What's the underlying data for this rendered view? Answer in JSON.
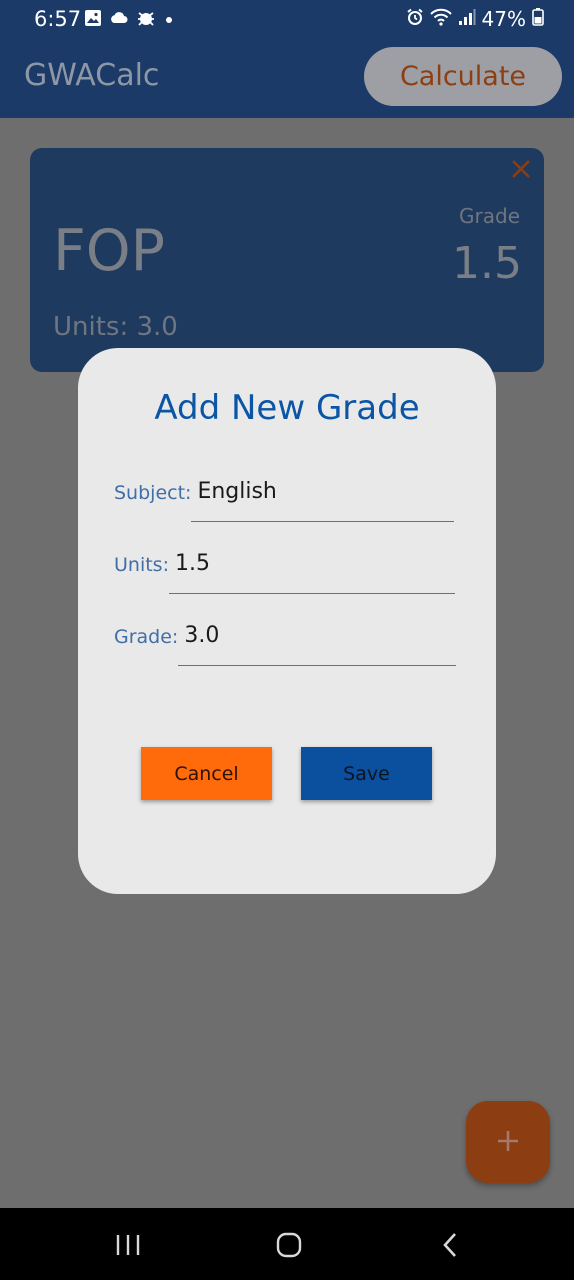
{
  "status_bar": {
    "time": "6:57",
    "battery": "47%",
    "icons": [
      "gallery-icon",
      "cloud-icon",
      "bug-icon",
      "dot-icon",
      "alarm-icon",
      "wifi-icon",
      "signal-icon",
      "battery-icon"
    ]
  },
  "app_bar": {
    "title": "GWACalc",
    "calculate_label": "Calculate"
  },
  "grade_card": {
    "subject": "FOP",
    "units_text": "Units: 3.0",
    "grade_label": "Grade",
    "grade_value": "1.5",
    "close_icon": "close-icon"
  },
  "dialog": {
    "title": "Add New Grade",
    "fields": [
      {
        "label": "Subject:",
        "value": "English"
      },
      {
        "label": "Units:",
        "value": "1.5"
      },
      {
        "label": "Grade:",
        "value": "3.0"
      }
    ],
    "cancel_label": "Cancel",
    "save_label": "Save"
  },
  "fab": {
    "icon": "plus-icon"
  },
  "nav_bar": {
    "icons": [
      "recents-icon",
      "home-icon",
      "back-icon"
    ]
  },
  "colors": {
    "app_bar": "#1c3a67",
    "card": "#1f3a5f",
    "scrim": "#6e6e6e",
    "dialog_bg": "#e9e9e9",
    "title_blue": "#0a55a6",
    "cancel_orange": "#ff6b0a",
    "save_blue": "#0b4f9f",
    "fab": "#8c3d12"
  }
}
